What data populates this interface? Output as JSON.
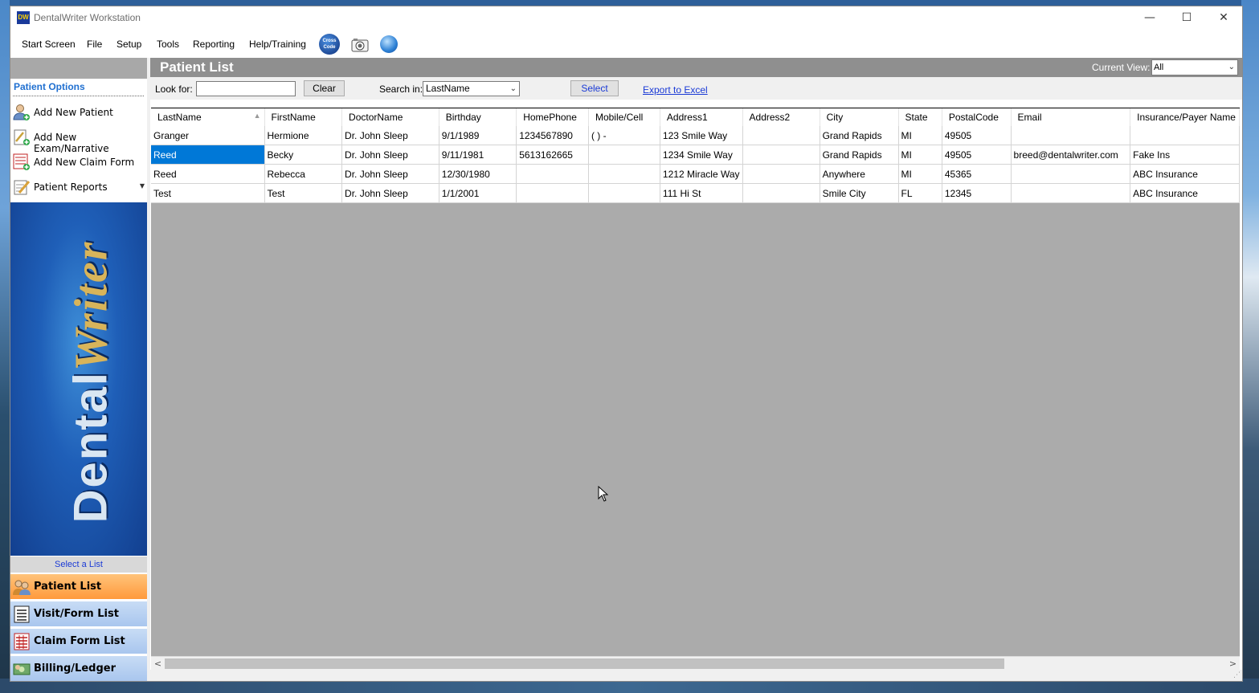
{
  "window": {
    "logo_text": "DW",
    "title": "DentalWriter Workstation",
    "controls": {
      "minimize": "—",
      "maximize": "☐",
      "close": "✕"
    }
  },
  "menu": {
    "items": [
      "Start Screen",
      "File",
      "Setup",
      "Tools",
      "Reporting",
      "Help/Training"
    ],
    "icons": [
      "crosscode-icon",
      "camera-icon",
      "globe-icon"
    ],
    "crosscode_text": "Cross Code"
  },
  "sidebar": {
    "header": "Patient Options",
    "options": [
      {
        "label": "Add New Patient",
        "icon": "add-patient-icon"
      },
      {
        "label": "Add New Exam/Narrative",
        "icon": "add-exam-icon"
      },
      {
        "label": "Add New Claim Form",
        "icon": "add-claim-icon"
      },
      {
        "label": "Patient Reports",
        "icon": "reports-icon"
      }
    ],
    "banner_part1": "Dental",
    "banner_part2": "Writer",
    "select_list_label": "Select a List",
    "nav": [
      {
        "label": "Patient List",
        "icon": "patient-list-icon",
        "active": true
      },
      {
        "label": "Visit/Form List",
        "icon": "visit-form-list-icon",
        "active": false
      },
      {
        "label": "Claim Form List",
        "icon": "claim-form-list-icon",
        "active": false
      },
      {
        "label": "Billing/Ledger",
        "icon": "billing-ledger-icon",
        "active": false
      }
    ]
  },
  "main": {
    "title": "Patient List",
    "current_view_label": "Current View:",
    "current_view_value": "All",
    "look_for_label": "Look for:",
    "look_for_value": "",
    "clear_label": "Clear",
    "search_in_label": "Search in:",
    "search_in_value": "LastName",
    "select_label": "Select",
    "export_label": "Export to Excel"
  },
  "table": {
    "columns": [
      "LastName",
      "FirstName",
      "DoctorName",
      "Birthday",
      "HomePhone",
      "Mobile/Cell",
      "Address1",
      "Address2",
      "City",
      "State",
      "PostalCode",
      "Email",
      "Insurance/Payer Name"
    ],
    "sorted_column": "LastName",
    "rows": [
      [
        "Granger",
        "Hermione",
        "Dr. John Sleep",
        "9/1/1989",
        "1234567890",
        "(   )    -",
        "123 Smile Way",
        "",
        "Grand Rapids",
        "MI",
        "49505",
        "",
        ""
      ],
      [
        "Reed",
        "Becky",
        "Dr. John Sleep",
        "9/11/1981",
        "5613162665",
        "",
        "1234 Smile Way",
        "",
        "Grand Rapids",
        "MI",
        "49505",
        "breed@dentalwriter.com",
        "Fake Ins"
      ],
      [
        "Reed",
        "Rebecca",
        "Dr. John Sleep",
        "12/30/1980",
        "",
        "",
        "1212 Miracle Way",
        "",
        "Anywhere",
        "MI",
        "45365",
        "",
        "ABC Insurance"
      ],
      [
        "Test",
        "Test",
        "Dr. John Sleep",
        "1/1/2001",
        "",
        "",
        "111 Hi St",
        "",
        "Smile City",
        "FL",
        "12345",
        "",
        "ABC Insurance"
      ]
    ],
    "selected_row": 1
  },
  "colors": {
    "accent_blue": "#1f6fd0",
    "selection": "#0078d7",
    "header_gray": "#8f8f8f",
    "nav_active": "#ff9a3c",
    "nav_inactive": "#a9c6ee"
  }
}
